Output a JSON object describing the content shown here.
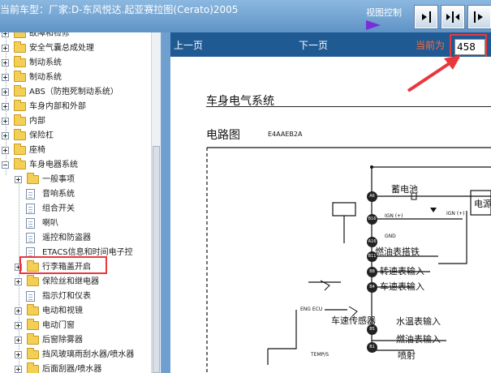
{
  "window": {
    "title": "当前车型：厂家:D-东风悦达.起亚赛拉图(Cerato)2005"
  },
  "view_control": {
    "label": "视图控制",
    "buttons": [
      "next-page-icon",
      "split-view-icon",
      "last-page-icon"
    ]
  },
  "nav": {
    "prev_label": "上一页",
    "next_label": "下一页",
    "current_label": "当前为",
    "current_page": "458"
  },
  "tree": {
    "items": [
      {
        "label": "故障和检修",
        "type": "folder",
        "expander": "plus"
      },
      {
        "label": "安全气囊总成处理",
        "type": "folder",
        "expander": "plus"
      },
      {
        "label": "制动系统",
        "type": "folder",
        "expander": "plus"
      },
      {
        "label": "制动系统",
        "type": "folder",
        "expander": "plus"
      },
      {
        "label": "ABS（防抱死制动系统）",
        "type": "folder",
        "expander": "plus"
      },
      {
        "label": "车身内部和外部",
        "type": "folder",
        "expander": "plus"
      },
      {
        "label": "内部",
        "type": "folder",
        "expander": "plus"
      },
      {
        "label": "保险杠",
        "type": "folder",
        "expander": "plus"
      },
      {
        "label": "座椅",
        "type": "folder",
        "expander": "plus"
      },
      {
        "label": "车身电器系统",
        "type": "folder",
        "expander": "minus"
      },
      {
        "label": "一般事项",
        "type": "folder",
        "expander": "plus"
      },
      {
        "label": "音响系统",
        "type": "doc",
        "expander": ""
      },
      {
        "label": "组合开关",
        "type": "doc",
        "expander": ""
      },
      {
        "label": "喇叭",
        "type": "doc",
        "expander": ""
      },
      {
        "label": "遥控和防盗器",
        "type": "doc",
        "expander": ""
      },
      {
        "label": "ETACS信息和时间电子控",
        "type": "doc",
        "expander": ""
      },
      {
        "label": "行李箱盖开启",
        "type": "folder",
        "expander": "plus"
      },
      {
        "label": "保险丝和继电器",
        "type": "folder",
        "expander": "plus"
      },
      {
        "label": "指示灯和仪表",
        "type": "doc",
        "expander": ""
      },
      {
        "label": "电动和视镜",
        "type": "folder",
        "expander": "plus"
      },
      {
        "label": "电动门窗",
        "type": "folder",
        "expander": "plus"
      },
      {
        "label": "后窗除雾器",
        "type": "folder",
        "expander": "plus"
      },
      {
        "label": "挡风玻璃雨刮水器/喷水器",
        "type": "folder",
        "expander": "plus"
      },
      {
        "label": "后面刮器/喷水器",
        "type": "folder",
        "expander": "plus"
      }
    ]
  },
  "document": {
    "title": "车身电气系统",
    "subtitle": "电路图",
    "code": "E4AAEB2A",
    "circuit": {
      "pins": [
        "A6",
        "B16",
        "A16",
        "B11",
        "B8",
        "B4",
        "B5",
        "B1"
      ],
      "labels": [
        "蓄电池",
        "燃油表搭铁",
        "转速表输入",
        "车速表输入",
        "车速传感器",
        "水温表输入",
        "燃油表输入",
        "喷射",
        "电源"
      ],
      "small_labels": [
        "IGN (+)",
        "GND",
        "ENG ECU",
        "TEMP/S",
        "IGN (+)"
      ]
    }
  },
  "colors": {
    "accent_red": "#e8383e",
    "nav_bg": "#1f5a93",
    "topbar": "#7aa9d4",
    "view_arrow": "#7a2fd6"
  }
}
